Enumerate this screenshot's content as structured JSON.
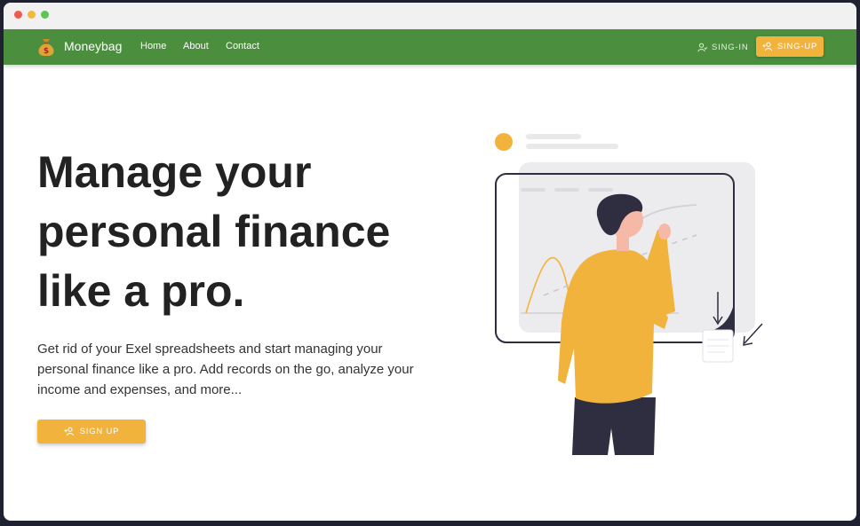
{
  "navbar": {
    "brand": "Moneybag",
    "links": [
      {
        "label": "Home"
      },
      {
        "label": "About"
      },
      {
        "label": "Contact"
      }
    ],
    "signin_label": "SING-IN",
    "signup_label": "SING-UP"
  },
  "hero": {
    "title": "Manage your personal finance like a pro.",
    "description": "Get rid of your Exel spreadsheets and start managing your personal finance like a pro. Add records on the go, analyze your income and expenses, and more...",
    "cta_label": "SIGN UP"
  },
  "colors": {
    "navbar": "#4b8f3e",
    "accent": "#f2b33d",
    "title_text": "#222222"
  },
  "icons": [
    "money-bag-icon",
    "user-icon",
    "add-user-icon"
  ]
}
